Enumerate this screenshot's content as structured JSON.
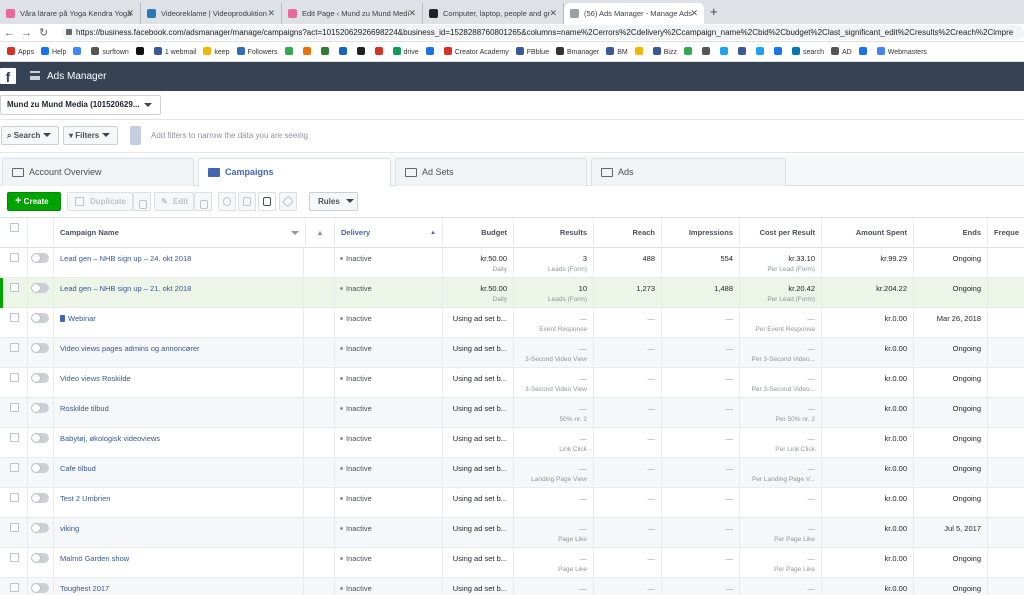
{
  "browser": {
    "tabs": [
      {
        "title": "Våra lärare på Yoga Kendra Yoga",
        "color": "#e86a9b"
      },
      {
        "title": "Videoreklame | Videoproduktion",
        "color": "#2a7ab8"
      },
      {
        "title": "Edit Page ‹ Mund zu Mund Medi",
        "color": "#e86a9b"
      },
      {
        "title": "Computer, laptop, people and gr",
        "color": "#222222"
      },
      {
        "title": "(56) Ads Manager - Manage Ads",
        "color": "#9aa0a6"
      }
    ],
    "new_tab": "+",
    "url": "https://business.facebook.com/adsmanager/manage/campaigns?act=10152062926698224&business_id=1528288760801265&columns=name%2Cerrors%2Cdelivery%2Ccampaign_name%2Cbid%2Cbudget%2Clast_significant_edit%2Cresults%2Creach%2Cimpre",
    "bookmarks": [
      {
        "label": "Apps",
        "color": "#d93025"
      },
      {
        "label": "Help",
        "color": "#1a73e8"
      },
      {
        "label": "",
        "color": "#4285f4"
      },
      {
        "label": "surftown",
        "color": "#555555"
      },
      {
        "label": "",
        "color": "#111111"
      },
      {
        "label": "1 webmail",
        "color": "#3b5998"
      },
      {
        "label": "keep",
        "color": "#f4b400"
      },
      {
        "label": "Followers",
        "color": "#2c6fb8"
      },
      {
        "label": "",
        "color": "#35a853"
      },
      {
        "label": "",
        "color": "#e8710a"
      },
      {
        "label": "",
        "color": "#2e7d32"
      },
      {
        "label": "",
        "color": "#1565c0"
      },
      {
        "label": "",
        "color": "#222222"
      },
      {
        "label": "",
        "color": "#d93025"
      },
      {
        "label": "drive",
        "color": "#0f9d58"
      },
      {
        "label": "",
        "color": "#1a73e8"
      },
      {
        "label": "Creator Academy",
        "color": "#d93025"
      },
      {
        "label": "FBblue",
        "color": "#3b5998"
      },
      {
        "label": "Bmanager",
        "color": "#333333"
      },
      {
        "label": "BM",
        "color": "#3b5998"
      },
      {
        "label": "",
        "color": "#f4b400"
      },
      {
        "label": "Bizz",
        "color": "#3b5998"
      },
      {
        "label": "",
        "color": "#34a853"
      },
      {
        "label": "",
        "color": "#555555"
      },
      {
        "label": "",
        "color": "#1da1f2"
      },
      {
        "label": "",
        "color": "#3b5998"
      },
      {
        "label": "",
        "color": "#1da1f2"
      },
      {
        "label": "",
        "color": "#1a73e8"
      },
      {
        "label": "search",
        "color": "#0077b5"
      },
      {
        "label": "AD",
        "color": "#555555"
      },
      {
        "label": "",
        "color": "#1a73e8"
      },
      {
        "label": "Webmasters",
        "color": "#4285f4"
      }
    ]
  },
  "header": {
    "logo": "f",
    "title": "Ads Manager"
  },
  "account": {
    "name": "Mund zu Mund Media (101520629..."
  },
  "filters": {
    "search_label": "Search",
    "filters_label": "Filters",
    "placeholder": "Add filters to narrow the data you are seeing"
  },
  "levels": [
    {
      "label": "Account Overview",
      "active": false
    },
    {
      "label": "Campaigns",
      "active": true
    },
    {
      "label": "Ad Sets",
      "active": false
    },
    {
      "label": "Ads",
      "active": false
    }
  ],
  "toolbar": {
    "create": "Create",
    "duplicate": "Duplicate",
    "edit": "Edit",
    "rules": "Rules"
  },
  "columns": {
    "name": "Campaign Name",
    "delivery": "Delivery",
    "budget": "Budget",
    "results": "Results",
    "reach": "Reach",
    "impressions": "Impressions",
    "cpr": "Cost per Result",
    "spent": "Amount Spent",
    "ends": "Ends",
    "freq": "Freque"
  },
  "rows": [
    {
      "name": "Lead gen – NHB sign up – 24. okt 2018",
      "delivery": "Inactive",
      "budget": "kr.50.00",
      "budget_sub": "Daily",
      "results": "3",
      "results_sub": "Leads (Form)",
      "reach": "488",
      "impressions": "554",
      "cpr": "kr.33.10",
      "cpr_sub": "Per Lead (Form)",
      "spent": "kr.99.29",
      "ends": "Ongoing"
    },
    {
      "name": "Lead gen – NHB sign up – 21. okt 2018",
      "delivery": "Inactive",
      "budget": "kr.50.00",
      "budget_sub": "Daily",
      "results": "10",
      "results_sub": "Leads (Form)",
      "reach": "1,273",
      "impressions": "1,488",
      "cpr": "kr.20.42",
      "cpr_sub": "Per Lead (Form)",
      "spent": "kr.204.22",
      "ends": "Ongoing"
    },
    {
      "name": "Webinar",
      "delivery": "Inactive",
      "budget": "Using ad set b...",
      "budget_sub": "",
      "results": "—",
      "results_sub": "Event Response",
      "reach": "—",
      "impressions": "—",
      "cpr": "—",
      "cpr_sub": "Per Event Response",
      "spent": "kr.0.00",
      "ends": "Mar 26, 2018"
    },
    {
      "name": "Video views pages admins og annoncører",
      "delivery": "Inactive",
      "budget": "Using ad set b...",
      "budget_sub": "",
      "results": "—",
      "results_sub": "3-Second Video View",
      "reach": "—",
      "impressions": "—",
      "cpr": "—",
      "cpr_sub": "Per 3-Second Video...",
      "spent": "kr.0.00",
      "ends": "Ongoing"
    },
    {
      "name": "Video views Roskilde",
      "delivery": "Inactive",
      "budget": "Using ad set b...",
      "budget_sub": "",
      "results": "—",
      "results_sub": "3-Second Video View",
      "reach": "—",
      "impressions": "—",
      "cpr": "—",
      "cpr_sub": "Per 3-Second Video...",
      "spent": "kr.0.00",
      "ends": "Ongoing"
    },
    {
      "name": "Roskilde tilbud",
      "delivery": "Inactive",
      "budget": "Using ad set b...",
      "budget_sub": "",
      "results": "—",
      "results_sub": "50% nr. 2",
      "reach": "—",
      "impressions": "—",
      "cpr": "—",
      "cpr_sub": "Per 50% nr. 2",
      "spent": "kr.0.00",
      "ends": "Ongoing"
    },
    {
      "name": "Babytøj, økologisk videoviews",
      "delivery": "Inactive",
      "budget": "Using ad set b...",
      "budget_sub": "",
      "results": "—",
      "results_sub": "Link Click",
      "reach": "—",
      "impressions": "—",
      "cpr": "—",
      "cpr_sub": "Per Link Click",
      "spent": "kr.0.00",
      "ends": "Ongoing"
    },
    {
      "name": "Cafe tilbud",
      "delivery": "Inactive",
      "budget": "Using ad set b...",
      "budget_sub": "",
      "results": "—",
      "results_sub": "Landing Page View",
      "reach": "—",
      "impressions": "—",
      "cpr": "—",
      "cpr_sub": "Per Landing Page V...",
      "spent": "kr.0.00",
      "ends": "Ongoing"
    },
    {
      "name": "Test 2 Umbrien",
      "delivery": "Inactive",
      "budget": "Using ad set b...",
      "budget_sub": "",
      "results": "—",
      "results_sub": "",
      "reach": "—",
      "impressions": "—",
      "cpr": "—",
      "cpr_sub": "",
      "spent": "kr.0.00",
      "ends": "Ongoing"
    },
    {
      "name": "viking",
      "delivery": "Inactive",
      "budget": "Using ad set b...",
      "budget_sub": "",
      "results": "—",
      "results_sub": "Page Like",
      "reach": "—",
      "impressions": "—",
      "cpr": "—",
      "cpr_sub": "Per Page Like",
      "spent": "kr.0.00",
      "ends": "Jul 5, 2017"
    },
    {
      "name": "Malmö Garden show",
      "delivery": "Inactive",
      "budget": "Using ad set b...",
      "budget_sub": "",
      "results": "—",
      "results_sub": "Page Like",
      "reach": "—",
      "impressions": "—",
      "cpr": "—",
      "cpr_sub": "Per Page Like",
      "spent": "kr.0.00",
      "ends": "Ongoing"
    },
    {
      "name": "Toughest 2017",
      "delivery": "Inactive",
      "budget": "Using ad set b...",
      "budget_sub": "",
      "results": "—",
      "results_sub": "Estimated Ad Reca...",
      "reach": "—",
      "impressions": "—",
      "cpr": "—",
      "cpr_sub": "Per Estimated Ad R...",
      "spent": "kr.0.00",
      "ends": "Ongoing"
    }
  ]
}
